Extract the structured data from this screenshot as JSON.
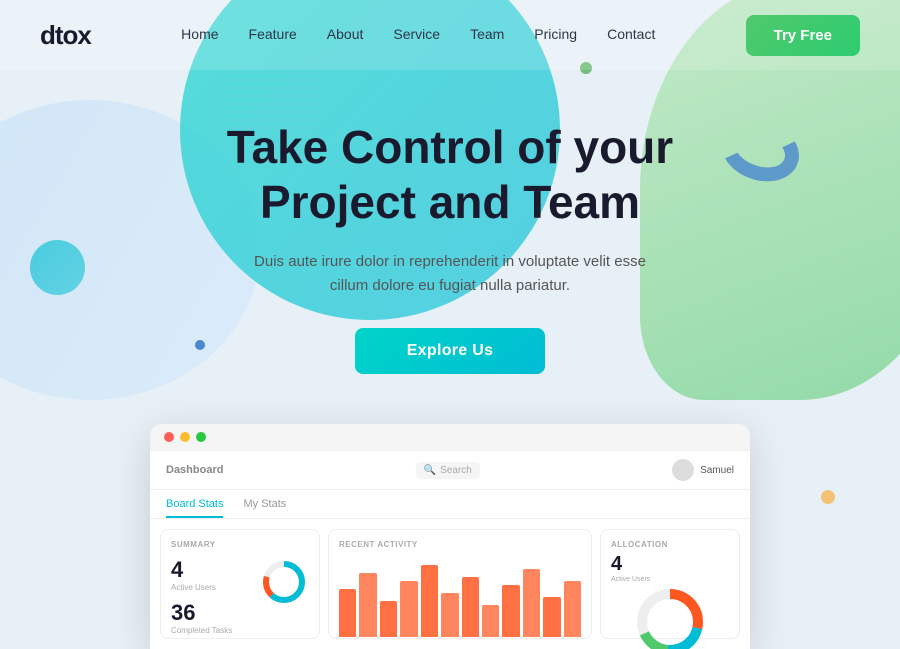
{
  "brand": {
    "logo": "dtox"
  },
  "navbar": {
    "links": [
      {
        "label": "Home",
        "id": "home"
      },
      {
        "label": "Feature",
        "id": "feature"
      },
      {
        "label": "About",
        "id": "about"
      },
      {
        "label": "Service",
        "id": "service"
      },
      {
        "label": "Team",
        "id": "team"
      },
      {
        "label": "Pricing",
        "id": "pricing"
      },
      {
        "label": "Contact",
        "id": "contact"
      }
    ],
    "cta": "Try Free"
  },
  "hero": {
    "headline_line1": "Take Control of your",
    "headline_line2": "Project and Team",
    "subtext": "Duis aute irure dolor in reprehenderit in voluptate velit esse cillum dolore eu fugiat nulla pariatur.",
    "cta": "Explore Us"
  },
  "dashboard": {
    "title": "Dashboard",
    "search_placeholder": "Search",
    "user": "Samuel",
    "tabs": [
      "Board Stats",
      "My Stats"
    ],
    "stats": {
      "label": "SUMMARY",
      "active_users_num": "4",
      "active_users_label": "Active Users",
      "completed_tasks_num": "36",
      "completed_tasks_label": "Completed Tasks"
    },
    "activity": {
      "label": "Recent Activity",
      "bars": [
        {
          "height": 60,
          "color": "#ff5722"
        },
        {
          "height": 80,
          "color": "#ff5722"
        },
        {
          "height": 45,
          "color": "#ff5722"
        },
        {
          "height": 70,
          "color": "#ff5722"
        },
        {
          "height": 90,
          "color": "#ff5722"
        },
        {
          "height": 55,
          "color": "#ff5722"
        },
        {
          "height": 75,
          "color": "#ff5722"
        },
        {
          "height": 40,
          "color": "#ff5722"
        },
        {
          "height": 65,
          "color": "#ff5722"
        },
        {
          "height": 85,
          "color": "#ff5722"
        },
        {
          "height": 50,
          "color": "#ff5722"
        },
        {
          "height": 70,
          "color": "#ff5722"
        }
      ]
    },
    "allocation": {
      "label": "ALLOCATION",
      "num": "4",
      "sub": "Active Users"
    }
  },
  "colors": {
    "teal": "#00bcd4",
    "green": "#4fc96b",
    "navy": "#1a1a2e",
    "cta_bg": "#4fc96b"
  }
}
